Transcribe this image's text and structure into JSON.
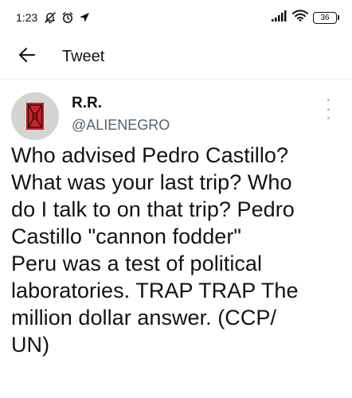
{
  "status_bar": {
    "time": "1:23",
    "battery_level": "36"
  },
  "header": {
    "title": "Tweet"
  },
  "tweet": {
    "display_name": "R.R.",
    "handle": "@ALIENEGRO",
    "text_lines": [
      "Who advised Pedro Castillo?",
      "What was your last trip? Who",
      "do I talk to on that trip? Pedro",
      "Castillo \"cannon fodder\"",
      "Peru was a test of political",
      "laboratories. TRAP TRAP The",
      "million dollar answer. (CCP/",
      "UN)"
    ]
  },
  "colors": {
    "text_primary": "#0f1419",
    "text_secondary": "#536471",
    "avatar_bg": "#d4d4d2",
    "avatar_accent": "#c8242b"
  },
  "icons": {
    "notification": "bell-off-icon",
    "alarm": "alarm-icon",
    "location": "navigation-arrow-icon",
    "signal": "signal-bars-icon",
    "wifi": "wifi-icon",
    "back": "arrow-left-icon",
    "more": "more-vertical-icon"
  }
}
